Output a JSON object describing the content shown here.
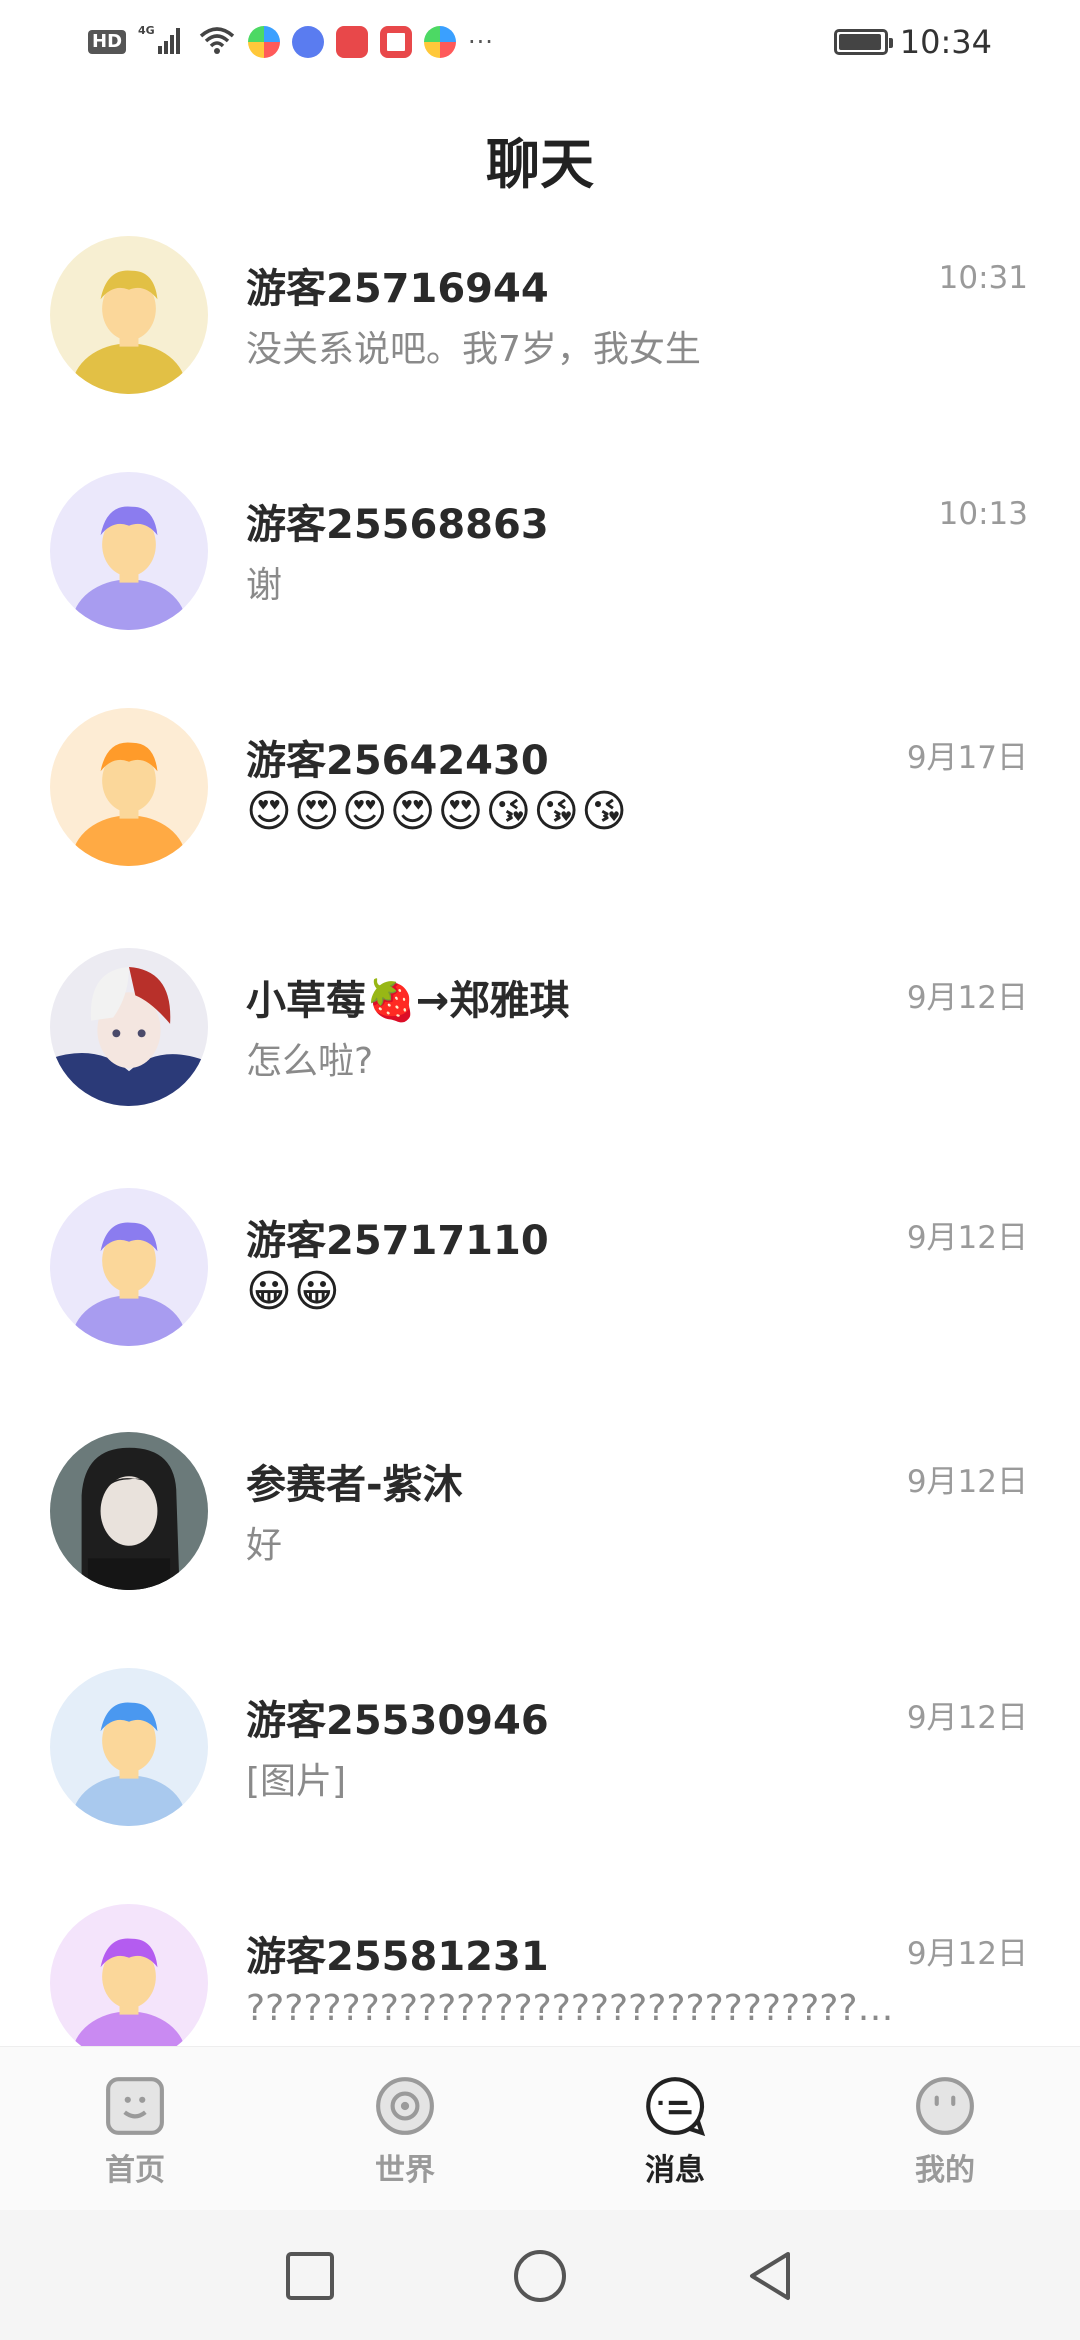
{
  "status_bar": {
    "network_badge": "HD",
    "signal": "4G",
    "time": "10:34",
    "icons": [
      "wifi-icon",
      "app-icon",
      "music-icon",
      "huawei-store-icon",
      "reader-icon",
      "app-icon"
    ],
    "more": "···"
  },
  "header": {
    "title": "聊天"
  },
  "chats": [
    {
      "name": "游客25716944",
      "message": "没关系说吧。我7岁，我女生",
      "time": "10:31",
      "avatar_color": "#e8c85a"
    },
    {
      "name": "游客25568863",
      "message": "谢",
      "time": "10:13",
      "avatar_color": "#a89cf0"
    },
    {
      "name": "游客25642430",
      "message": "😍😍😍😍😍😘😘😘",
      "time": "9月17日",
      "avatar_color": "#ffaa44"
    },
    {
      "name": "小草莓🍓→郑雅琪",
      "message": "怎么啦?",
      "time": "9月12日",
      "avatar_color": "#8a3a3a"
    },
    {
      "name": "游客25717110",
      "message": "😀😀",
      "time": "9月12日",
      "avatar_color": "#a89cf0"
    },
    {
      "name": "参赛者-紫沐",
      "message": "好",
      "time": "9月12日",
      "avatar_color": "#3a3a3a"
    },
    {
      "name": "游客25530946",
      "message": "[图片]",
      "time": "9月12日",
      "avatar_color": "#5aa0f0"
    },
    {
      "name": "游客25581231",
      "message": "???????????????????????????????????...",
      "time": "9月12日",
      "avatar_color": "#c074f0"
    }
  ],
  "tabs": [
    {
      "label": "首页",
      "icon": "home-face-icon",
      "active": false
    },
    {
      "label": "世界",
      "icon": "world-ring-icon",
      "active": false
    },
    {
      "label": "消息",
      "icon": "message-bubble-icon",
      "active": true
    },
    {
      "label": "我的",
      "icon": "profile-face-icon",
      "active": false
    }
  ],
  "nav": [
    "recents-square-icon",
    "home-circle-icon",
    "back-triangle-icon"
  ]
}
